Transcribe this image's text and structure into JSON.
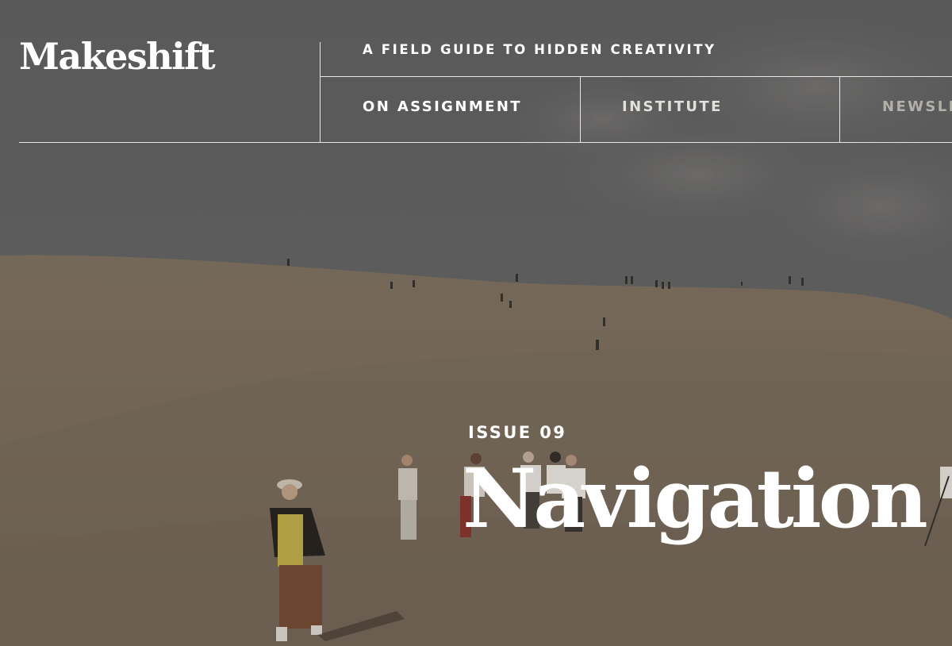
{
  "site": {
    "logo": "Makeshift",
    "tagline": "A FIELD GUIDE TO HIDDEN CREATIVITY"
  },
  "nav": {
    "items": [
      {
        "label": "ON ASSIGNMENT",
        "color": "#ffffff"
      },
      {
        "label": "INSTITUTE",
        "color": "#e2e0dc"
      },
      {
        "label": "NEWSLE",
        "color": "#b3b0ab"
      }
    ]
  },
  "hero": {
    "kicker": "ISSUE 09",
    "title": "Navigation",
    "image": "desert-sand-dunes-with-tourists"
  },
  "colors": {
    "text": "#ffffff",
    "rule": "#ffffff",
    "sky": "#6a6a6b",
    "sand": "#8b7c69"
  }
}
